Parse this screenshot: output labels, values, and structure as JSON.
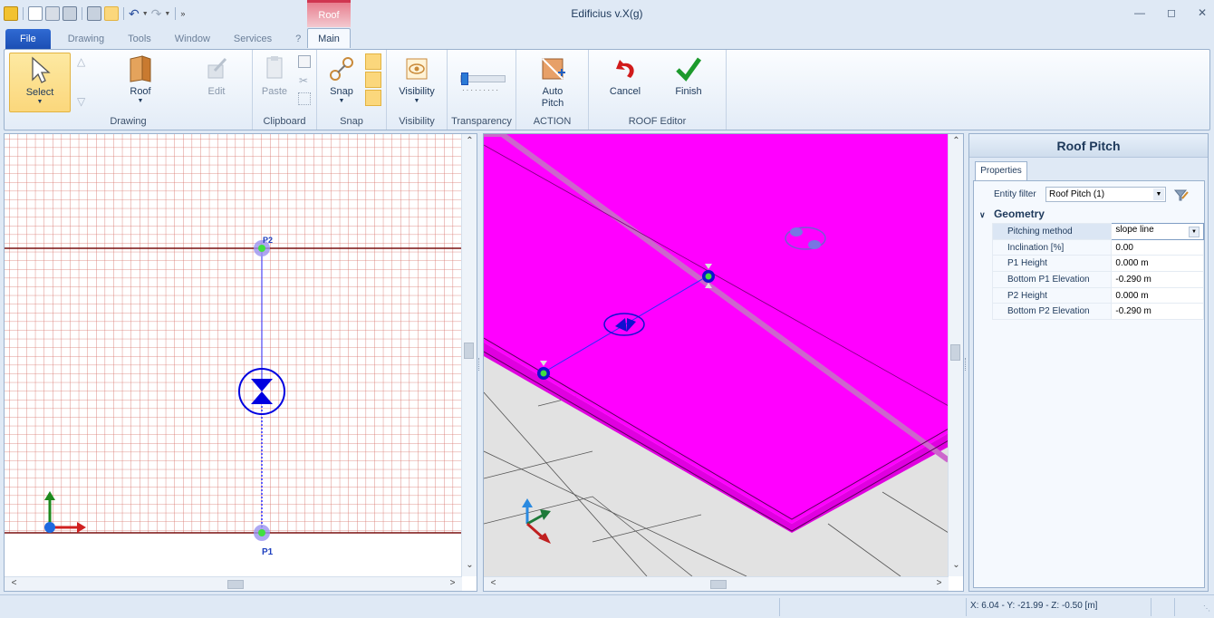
{
  "app": {
    "title": "Edificius v.X(g)",
    "context_tab": "Roof"
  },
  "tabs": [
    {
      "label": "File"
    },
    {
      "label": "Drawing"
    },
    {
      "label": "Tools"
    },
    {
      "label": "Window"
    },
    {
      "label": "Services"
    },
    {
      "label": "?"
    },
    {
      "label": "Main"
    }
  ],
  "ribbon": {
    "drawing": {
      "label": "Drawing",
      "select": "Select",
      "roof": "Roof",
      "edit": "Edit"
    },
    "clipboard": {
      "label": "Clipboard",
      "paste": "Paste"
    },
    "snap": {
      "label": "Snap",
      "snap": "Snap"
    },
    "visibility": {
      "label": "Visibility",
      "visibility": "Visibility"
    },
    "transparency": {
      "label": "Transparency"
    },
    "action": {
      "label": "ACTION",
      "auto_pitch_1": "Auto",
      "auto_pitch_2": "Pitch"
    },
    "roof_editor": {
      "label": "ROOF Editor",
      "cancel": "Cancel",
      "finish": "Finish"
    }
  },
  "plan_view": {
    "p1": "P1",
    "p2": "P2"
  },
  "properties": {
    "title": "Roof Pitch",
    "tab": "Properties",
    "entity_filter_label": "Entity filter",
    "entity_filter_value": "Roof Pitch (1)",
    "category": "Geometry",
    "rows": [
      {
        "name": "Pitching method",
        "value": "slope line"
      },
      {
        "name": "Inclination  [%]",
        "value": "0.00"
      },
      {
        "name": "P1 Height",
        "value": "0.000 m"
      },
      {
        "name": "Bottom P1 Elevation",
        "value": "-0.290 m"
      },
      {
        "name": "P2 Height",
        "value": "0.000 m"
      },
      {
        "name": "Bottom P2 Elevation",
        "value": "-0.290 m"
      }
    ]
  },
  "status": {
    "coords": "X: 6.04 - Y: -21.99 - Z: -0.50 [m]"
  },
  "colors": {
    "roof": "#ff00ff",
    "accent": "#2f6ad3",
    "grid": "#c8504a"
  }
}
